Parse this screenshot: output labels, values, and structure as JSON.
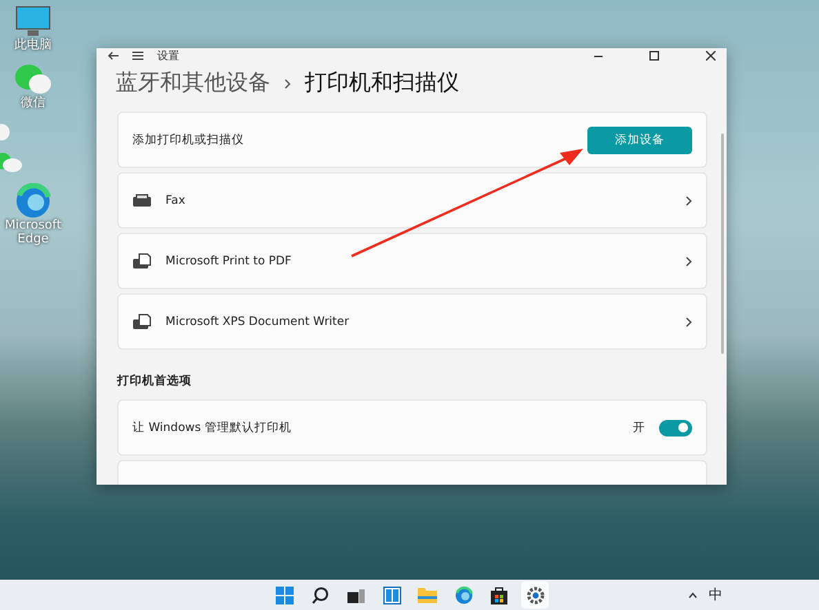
{
  "desktop_icons": [
    {
      "kind": "pc",
      "label": "此电脑"
    },
    {
      "kind": "chat",
      "label": "微信"
    },
    {
      "kind": "bubble"
    },
    {
      "kind": "chat-edge"
    },
    {
      "kind": "browser",
      "label": "Microsoft Edge"
    }
  ],
  "window": {
    "title": "设置",
    "breadcrumb": [
      "蓝牙和其他设备",
      "打印机和扫描仪"
    ]
  },
  "add_row": {
    "label": "添加打印机或扫描仪",
    "button": "添加设备"
  },
  "printers": [
    {
      "kind": "fax",
      "name": "Fax"
    },
    {
      "kind": "printer",
      "name": "Microsoft Print to PDF"
    },
    {
      "kind": "printer",
      "name": "Microsoft XPS Document Writer"
    }
  ],
  "preferences": {
    "title": "打印机首选项",
    "items": [
      {
        "label": "让 Windows 管理默认打印机",
        "state_label": "开",
        "on": true
      }
    ]
  },
  "taskbar": {
    "items": [
      {
        "kind": "start",
        "selected": false
      },
      {
        "kind": "search",
        "selected": false
      },
      {
        "kind": "taskview",
        "selected": false
      },
      {
        "kind": "widgets",
        "selected": false
      },
      {
        "kind": "folder",
        "selected": false
      },
      {
        "kind": "browser",
        "selected": false
      },
      {
        "kind": "store",
        "selected": false
      },
      {
        "kind": "settings",
        "selected": true
      }
    ],
    "ime": "中"
  }
}
